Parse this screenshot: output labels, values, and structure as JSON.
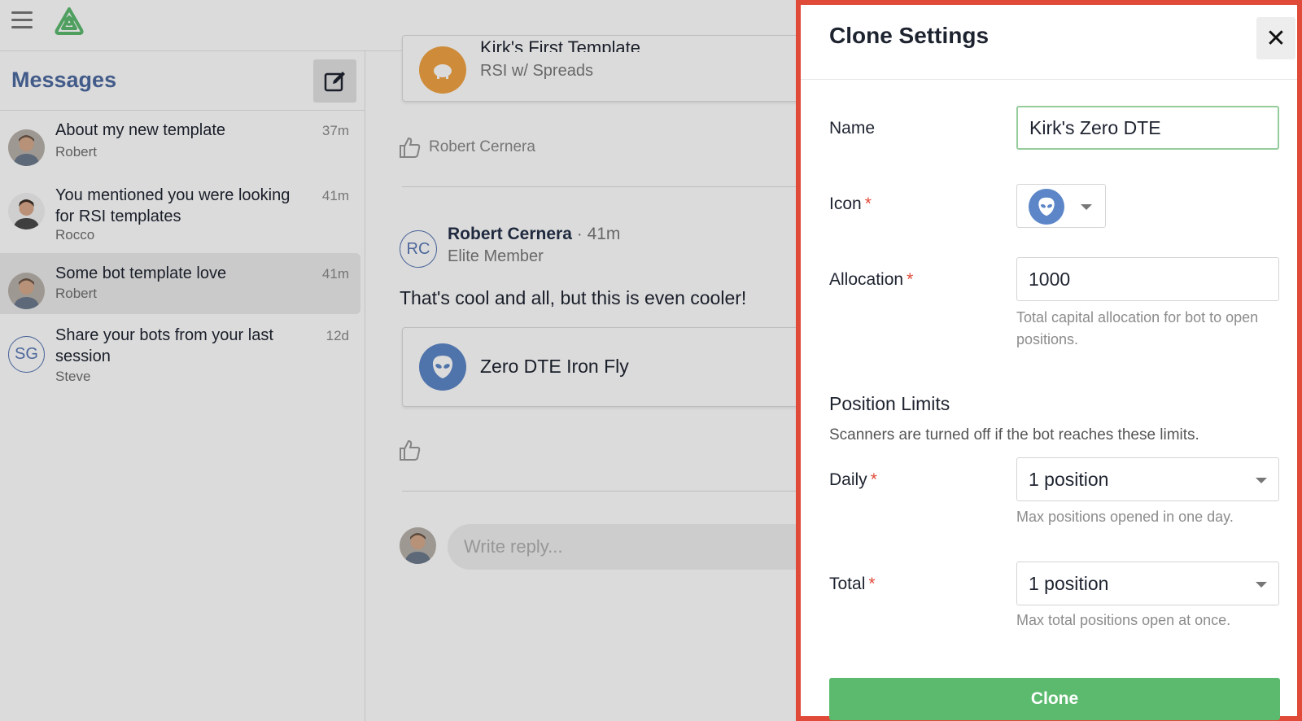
{
  "sidebar": {
    "title": "Messages",
    "items": [
      {
        "title": "About my new template",
        "sender": "Robert",
        "time": "37m"
      },
      {
        "title": "You mentioned you were looking for RSI templates",
        "sender": "Rocco",
        "time": "41m"
      },
      {
        "title": "Some bot template love",
        "sender": "Robert",
        "time": "41m"
      },
      {
        "title": "Share your bots from your last session",
        "sender": "Steve",
        "time": "12d",
        "initials": "SG"
      }
    ]
  },
  "thread": {
    "top_card": {
      "title": "Kirk's First Template",
      "subtitle": "RSI w/ Spreads"
    },
    "top_like_name": "Robert Cernera",
    "post": {
      "initials": "RC",
      "author": "Robert Cernera",
      "separator": " · ",
      "time": "41m",
      "role": "Elite Member",
      "text": "That's cool and all, but this is even cooler!",
      "card_title": "Zero DTE Iron Fly"
    },
    "reply_placeholder": "Write reply..."
  },
  "drawer": {
    "title": "Clone Settings",
    "close_label": "✕",
    "name_label": "Name",
    "name_value": "Kirk's Zero DTE",
    "icon_label": "Icon",
    "allocation_label": "Allocation",
    "allocation_value": "1000",
    "allocation_help": "Total capital allocation for bot to open positions.",
    "position_limits_title": "Position Limits",
    "position_limits_desc": "Scanners are turned off if the bot reaches these limits.",
    "daily_label": "Daily",
    "daily_value": "1 position",
    "daily_help": "Max positions opened in one day.",
    "total_label": "Total",
    "total_value": "1 position",
    "total_help": "Max total positions open at once.",
    "clone_label": "Clone",
    "required_mark": "*"
  },
  "colors": {
    "accent_green": "#5cba6f",
    "required_red": "#e04a39",
    "link_blue": "#4d6aa0",
    "bot_icon_blue": "#5c86c8",
    "bot_icon_orange": "#f0a444"
  }
}
